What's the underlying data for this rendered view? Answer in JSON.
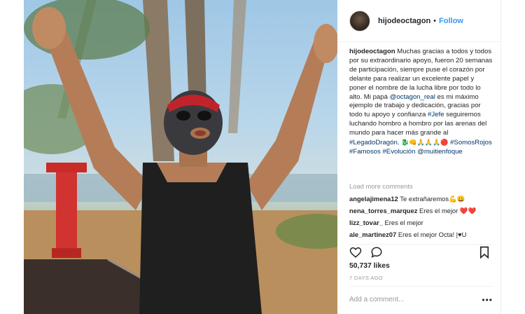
{
  "post": {
    "username": "hijodeoctagon",
    "follow_label": "Follow",
    "separator": "•",
    "caption": {
      "username": "hijodeoctagon",
      "text_1": "Muchas gracias a todos y todos por su extraordinario apoyo, fueron 20 semanas de participación, siempre puse el corazón por delante para realizar un excelente papel y poner el nombre de la lucha libre por todo lo alto. Mi papá",
      "mention_1": "@octagon_real",
      "text_2": "es mi máximo ejemplo de trabajo y dedicación, gracias por todo tu apoyo y confianza",
      "hashtag_1": "#Jefe",
      "text_3": "seguiremos luchando hombro a hombro por las arenas del mundo para hacer más grande al",
      "hashtag_2": "#LegadoDragón.",
      "emojis_1": "🐉👊🙏🙏🙏🔴",
      "hashtag_3": "#SomosRojos",
      "hashtag_4": "#Famosos",
      "hashtag_5": "#Evolución",
      "mention_2": "@muitienfoque"
    },
    "load_more": "Load more comments",
    "comments": [
      {
        "user": "angelajimena12",
        "text": "Te extrañaremos💪😀"
      },
      {
        "user": "nena_torres_marquez",
        "text": "Eres el mejor",
        "hearts": "❤️❤️"
      },
      {
        "user": "lizz_tovar_",
        "text": "Eres el mejor"
      },
      {
        "user": "ale_martinez07",
        "text": "Eres el mejor Octa! |♥U"
      }
    ],
    "likes": "50,737 likes",
    "time_ago": "7 DAYS AGO",
    "add_comment_placeholder": "Add a comment...",
    "more_options": "•••"
  },
  "icons": {
    "like": "heart-outline-icon",
    "comment": "speech-bubble-icon",
    "save": "bookmark-icon"
  },
  "colors": {
    "link_blue": "#3897f0",
    "hashtag_navy": "#003569",
    "muted_gray": "#999999",
    "heart_red": "#ed4956"
  }
}
